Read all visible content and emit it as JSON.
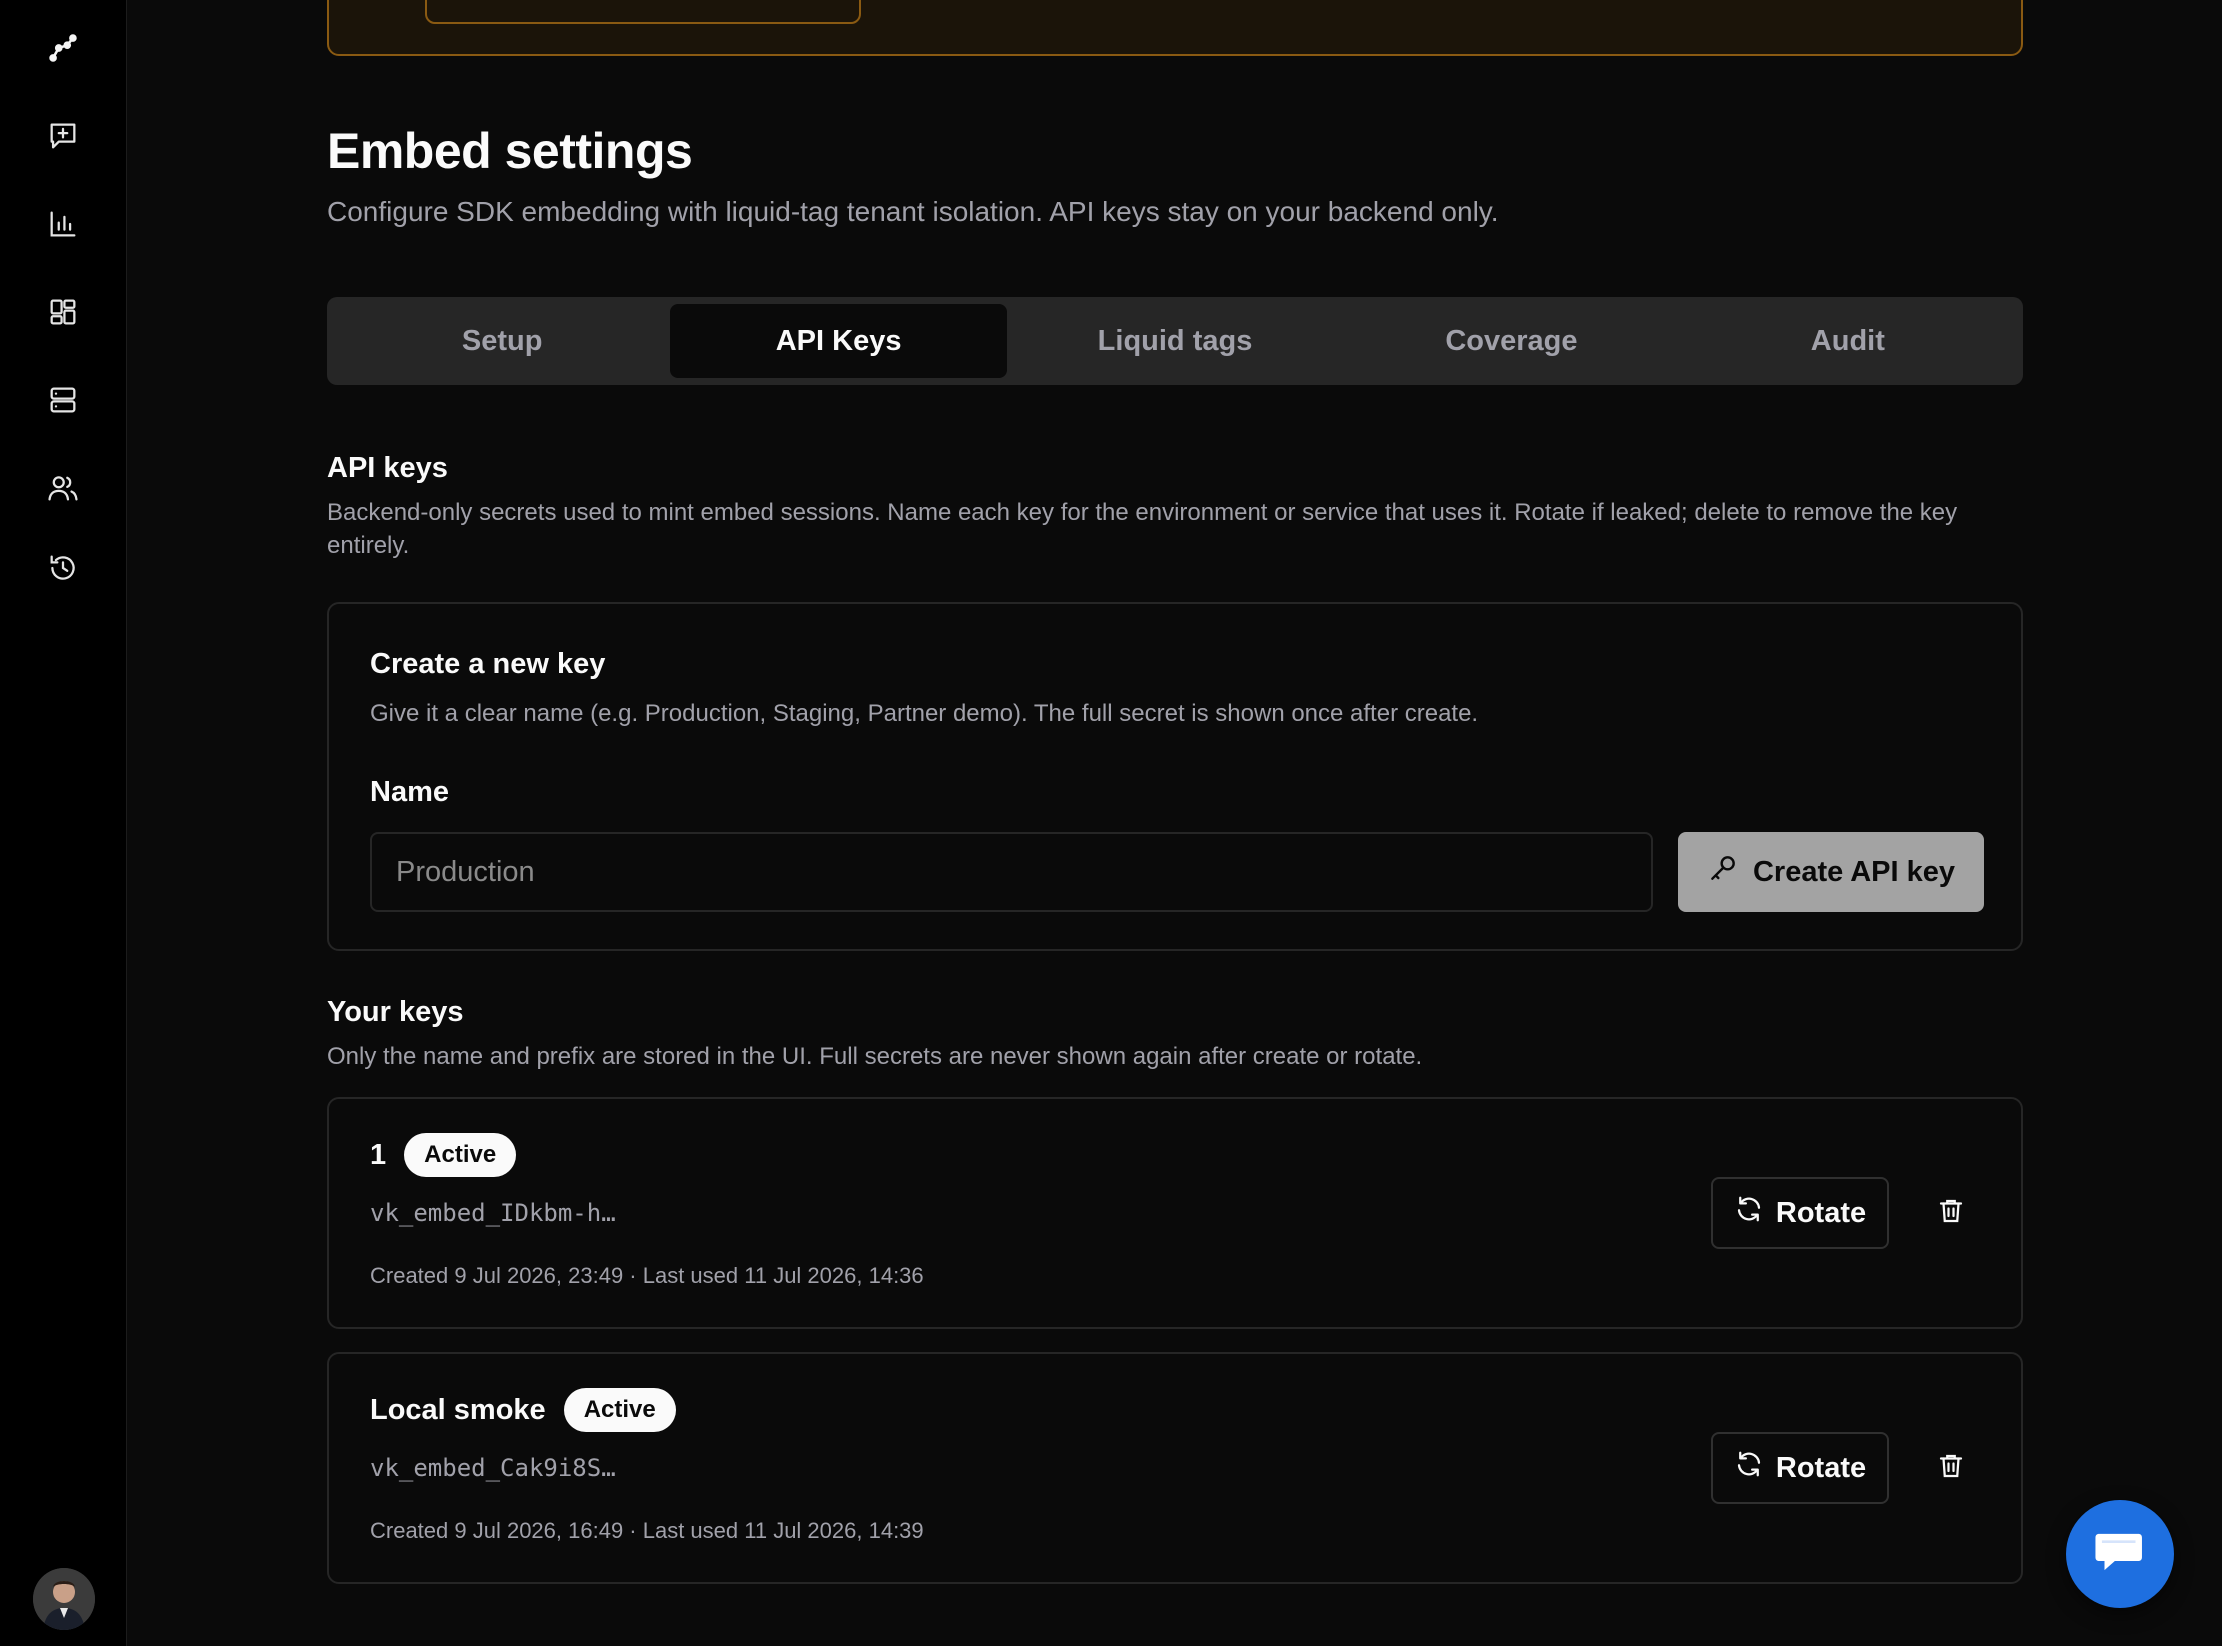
{
  "sidebar": {
    "items": [
      {
        "icon": "analytics-path-icon"
      },
      {
        "icon": "new-chat-icon"
      },
      {
        "icon": "bar-chart-icon"
      },
      {
        "icon": "dashboard-icon"
      },
      {
        "icon": "server-icon"
      },
      {
        "icon": "users-icon"
      },
      {
        "icon": "history-icon"
      }
    ]
  },
  "page": {
    "title": "Embed settings",
    "subtitle": "Configure SDK embedding with liquid-tag tenant isolation. API keys stay on your backend only."
  },
  "tabs": [
    {
      "label": "Setup",
      "active": false
    },
    {
      "label": "API Keys",
      "active": true
    },
    {
      "label": "Liquid tags",
      "active": false
    },
    {
      "label": "Coverage",
      "active": false
    },
    {
      "label": "Audit",
      "active": false
    }
  ],
  "api_keys": {
    "title": "API keys",
    "description": "Backend-only secrets used to mint embed sessions. Name each key for the environment or service that uses it. Rotate if leaked; delete to remove the key entirely."
  },
  "create": {
    "title": "Create a new key",
    "description": "Give it a clear name (e.g. Production, Staging, Partner demo). The full secret is shown once after create.",
    "name_label": "Name",
    "name_placeholder": "Production",
    "name_value": "",
    "button_label": "Create API key"
  },
  "your_keys": {
    "title": "Your keys",
    "description": "Only the name and prefix are stored in the UI. Full secrets are never shown again after create or rotate.",
    "rotate_label": "Rotate",
    "keys": [
      {
        "name": "1",
        "status": "Active",
        "prefix": "vk_embed_IDkbm-h…",
        "meta": "Created 9 Jul 2026, 23:49 · Last used 11 Jul 2026, 14:36"
      },
      {
        "name": "Local smoke",
        "status": "Active",
        "prefix": "vk_embed_Cak9i8S…",
        "meta": "Created 9 Jul 2026, 16:49 · Last used 11 Jul 2026, 14:39"
      }
    ]
  },
  "colors": {
    "background": "#0a0a0a",
    "banner_border": "#8a5a12",
    "chat_fab": "#1e6fe0",
    "badge_bg": "#fafafa"
  }
}
